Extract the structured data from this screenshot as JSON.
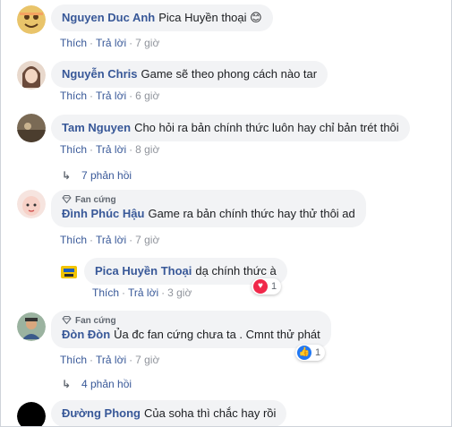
{
  "action_labels": {
    "like": "Thích",
    "reply": "Trả lời",
    "separator": "·"
  },
  "comments": [
    {
      "author": "Nguyen Duc Anh",
      "text": "Pica Huyền thoại",
      "emoji": "😊",
      "time": "7 giờ"
    },
    {
      "author": "Nguyễn Chris",
      "text": "Game sẽ theo phong cách nào tar",
      "time": "6 giờ"
    },
    {
      "author": "Tam Nguyen",
      "text": "Cho hỏi ra bản chính thức luôn hay chỉ bản trét thôi",
      "time": "8 giờ",
      "replies": "7 phản hồi"
    },
    {
      "badge": "Fan cứng",
      "author": "Đình Phúc Hậu",
      "text": "Game ra bản chính thức hay thử thôi ad",
      "time": "7 giờ"
    },
    {
      "author": "Pica Huyền Thoại",
      "text": "dạ chính thức à",
      "time": "3 giờ",
      "reaction_count": "1"
    },
    {
      "badge": "Fan cứng",
      "author": "Đòn Đòn",
      "text": "Ủa đc fan cứng chưa ta . Cmnt thử phát",
      "time": "7 giờ",
      "reaction_count": "1",
      "replies": "4 phản hồi"
    },
    {
      "author": "Đường Phong",
      "text": "Của soha thì chắc hay rồi"
    }
  ],
  "colors": {
    "author": "#385898",
    "bubble": "#f2f3f5",
    "meta": "#90949c",
    "love": "#f0284a",
    "like": "#2078f4"
  }
}
